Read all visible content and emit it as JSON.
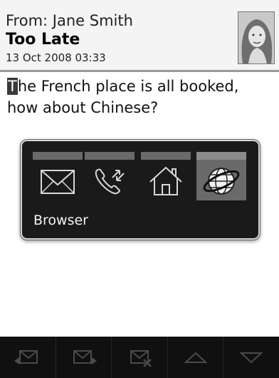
{
  "message": {
    "from_line": "From: Jane Smith",
    "subject": "Too Late",
    "date": "13 Oct 2008 03:33",
    "body_first_char": "T",
    "body_rest": "he French place is all booked, how about Chinese?"
  },
  "switcher": {
    "apps": [
      {
        "name": "Messages",
        "icon": "envelope-icon"
      },
      {
        "name": "Phone",
        "icon": "phone-icon"
      },
      {
        "name": "Home",
        "icon": "home-icon"
      },
      {
        "name": "Browser",
        "icon": "globe-icon"
      }
    ],
    "selected_label": "Browser"
  },
  "toolbar": {
    "buttons": [
      {
        "icon": "reply-icon"
      },
      {
        "icon": "forward-icon"
      },
      {
        "icon": "delete-message-icon"
      },
      {
        "icon": "up-arrow-icon"
      },
      {
        "icon": "down-arrow-icon"
      }
    ]
  },
  "colors": {
    "header_bg": "#f4f4f4",
    "switcher_bg": "#1a1a1a",
    "toolbar_bg": "#101010"
  }
}
